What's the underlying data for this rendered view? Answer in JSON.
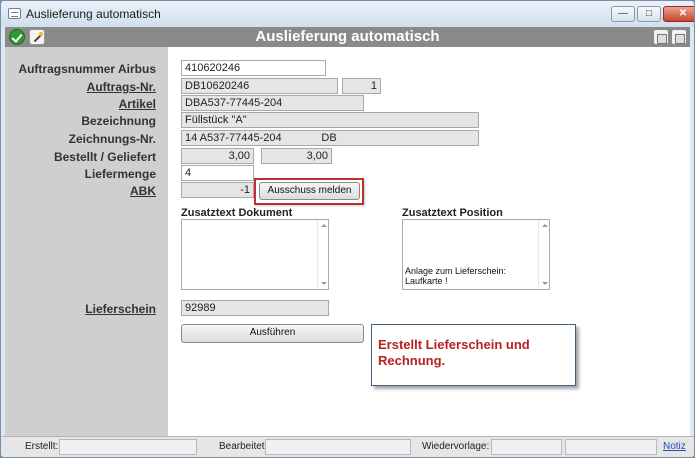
{
  "window": {
    "title": "Auslieferung automatisch"
  },
  "toolbar": {
    "title": "Auslieferung automatisch"
  },
  "labels": {
    "auftragsnummer_airbus": "Auftragsnummer Airbus",
    "auftrags_nr": "Auftrags-Nr.",
    "artikel": "Artikel",
    "bezeichnung": "Bezeichnung",
    "zeichnungs_nr": "Zeichnungs-Nr.",
    "bestellt_geliefert": "Bestellt / Geliefert",
    "liefermenge": "Liefermenge",
    "abk": "ABK",
    "lieferschein": "Lieferschein"
  },
  "fields": {
    "auftragsnummer_airbus": "410620246",
    "auftrags_nr": "DB10620246",
    "auftrags_pos": "1",
    "artikel": "DBA537-77445-204",
    "bezeichnung": "Füllstück \"A\"",
    "zeichnungs_nr": "14 A537-77445-204             DB",
    "bestellt": "3,00",
    "geliefert": "3,00",
    "liefermenge": "4",
    "abk": "-1",
    "lieferschein": "92989"
  },
  "buttons": {
    "ausschuss_melden": "Ausschuss melden",
    "ausfuehren": "Ausführen"
  },
  "zusatztext": {
    "dokument_label": "Zusatztext Dokument",
    "position_label": "Zusatztext Position",
    "position_line1": "Anlage zum Lieferschein:",
    "position_line2": "Laufkarte !"
  },
  "callout": {
    "text": "Erstellt Lieferschein und Rechnung."
  },
  "statusbar": {
    "erstellt_label": "Erstellt:",
    "bearbeitet_label": "Bearbeitet:",
    "wiedervorlage_label": "Wiedervorlage:",
    "notiz_link": "Notiz"
  },
  "colors": {
    "highlight_border": "#c22f2f",
    "callout_text": "#b42222",
    "toolbar_bg": "#8a8a8a"
  }
}
